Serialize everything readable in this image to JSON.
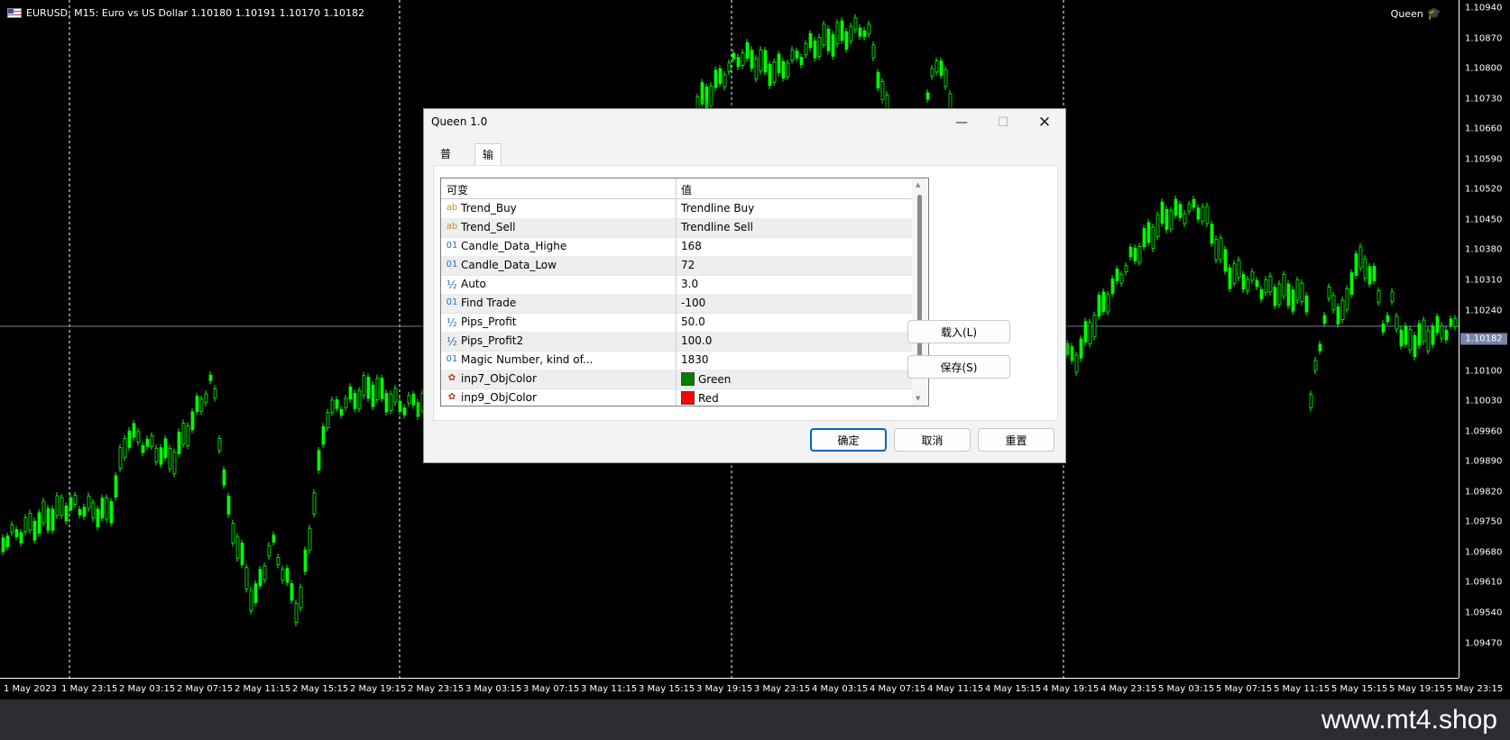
{
  "chart": {
    "symbol_line": "EURUSD, M15:  Euro vs US Dollar  1.10180 1.10191 1.10170 1.10182",
    "ea_name": "Queen",
    "current_price": "1.10182",
    "price_labels": [
      "1.10940",
      "1.10870",
      "1.10800",
      "1.10730",
      "1.10660",
      "1.10590",
      "1.10520",
      "1.10450",
      "1.10380",
      "1.10310",
      "1.10240",
      "1.10170",
      "1.10100",
      "1.10030",
      "1.09960",
      "1.09890",
      "1.09820",
      "1.09750",
      "1.09680",
      "1.09610",
      "1.09540",
      "1.09470"
    ],
    "time_labels": [
      "1 May 2023",
      "1 May 23:15",
      "2 May 03:15",
      "2 May 07:15",
      "2 May 11:15",
      "2 May 15:15",
      "2 May 19:15",
      "2 May 23:15",
      "3 May 03:15",
      "3 May 07:15",
      "3 May 11:15",
      "3 May 15:15",
      "3 May 19:15",
      "3 May 23:15",
      "4 May 03:15",
      "4 May 07:15",
      "4 May 11:15",
      "4 May 15:15",
      "4 May 19:15",
      "4 May 23:15",
      "5 May 03:15",
      "5 May 07:15",
      "5 May 11:15",
      "5 May 15:15",
      "5 May 19:15",
      "5 May 23:15"
    ],
    "candle_color": "#00ff00"
  },
  "dialog": {
    "title": "Queen  1.0",
    "tabs": [
      {
        "label": "普通"
      },
      {
        "label": "输入"
      }
    ],
    "columns": {
      "variable": "可变",
      "value": "值"
    },
    "rows": [
      {
        "icon": "ab",
        "name": "Trend_Buy",
        "value": "Trendline Buy"
      },
      {
        "icon": "ab",
        "name": "Trend_Sell",
        "value": "Trendline Sell"
      },
      {
        "icon": "01",
        "name": "Candle_Data_Highe",
        "value": "168"
      },
      {
        "icon": "01",
        "name": "Candle_Data_Low",
        "value": "72"
      },
      {
        "icon": "½",
        "name": "Auto",
        "value": "3.0"
      },
      {
        "icon": "01",
        "name": "Find Trade",
        "value": "-100"
      },
      {
        "icon": "½",
        "name": "Pips_Profit",
        "value": "50.0"
      },
      {
        "icon": "½",
        "name": "Pips_Profit2",
        "value": "100.0"
      },
      {
        "icon": "01",
        "name": "Magic Number, kind of...",
        "value": "1830"
      },
      {
        "icon": "color",
        "name": "inp7_ObjColor",
        "value": "Green",
        "swatch": "#008000"
      },
      {
        "icon": "color",
        "name": "inp9_ObjColor",
        "value": "Red",
        "swatch": "#ff0000"
      }
    ],
    "load_button": "载入(L)",
    "save_button": "保存(S)",
    "ok_button": "确定",
    "cancel_button": "取消",
    "reset_button": "重置"
  },
  "footer": {
    "watermark": "www.mt4.shop"
  }
}
